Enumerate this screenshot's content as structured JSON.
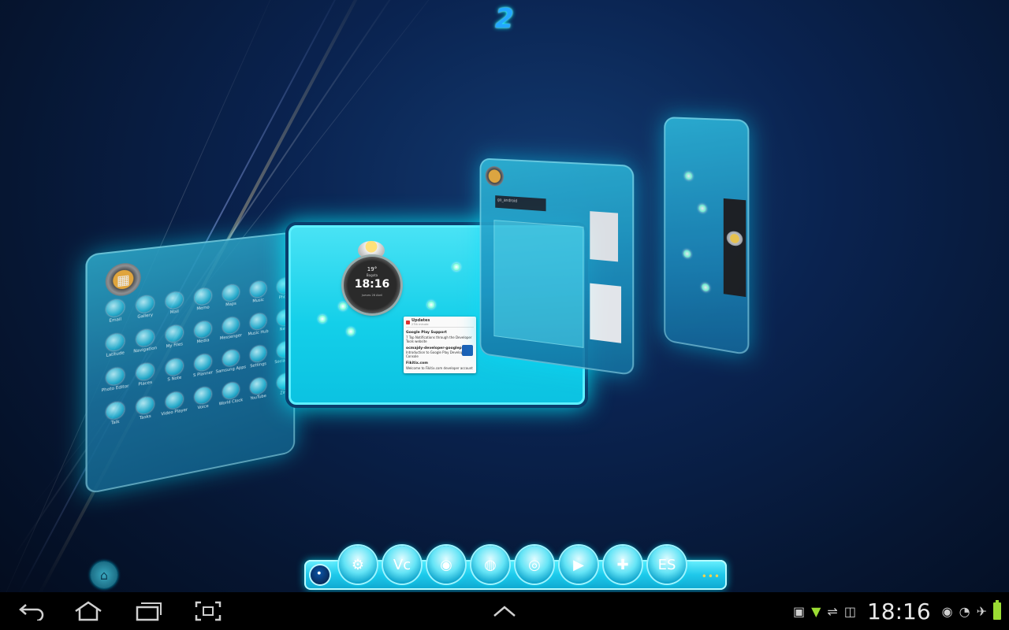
{
  "page_indicator": "2",
  "screens": {
    "left": {
      "apps": [
        {
          "label": "Email"
        },
        {
          "label": "Gallery"
        },
        {
          "label": "Mail"
        },
        {
          "label": "Memo"
        },
        {
          "label": "Maps"
        },
        {
          "label": "Music"
        },
        {
          "label": "Phone"
        },
        {
          "label": "Latitude"
        },
        {
          "label": "Navigation"
        },
        {
          "label": "My Files"
        },
        {
          "label": "Media"
        },
        {
          "label": "Messenger"
        },
        {
          "label": "Music Hub"
        },
        {
          "label": "News"
        },
        {
          "label": "Photo Editor"
        },
        {
          "label": "Places"
        },
        {
          "label": "S Note"
        },
        {
          "label": "S Planner"
        },
        {
          "label": "Samsung Apps"
        },
        {
          "label": "Settings"
        },
        {
          "label": "Social Hub"
        },
        {
          "label": "Talk"
        },
        {
          "label": "Tasks"
        },
        {
          "label": "Video Player"
        },
        {
          "label": "Voice"
        },
        {
          "label": "World Clock"
        },
        {
          "label": "YouTube"
        },
        {
          "label": "Zinio"
        }
      ]
    },
    "center": {
      "clock": {
        "temperature": "19°",
        "city": "Bogota",
        "time": "18:16",
        "date": "Jueves 26 Abril"
      },
      "notification": {
        "header": "Updates",
        "header_sub": "27th minute",
        "item1_title": "Google Play Support",
        "item1_text": "7 Top Notifications through the Developer Tools website",
        "item2_title": "ocmajdy-developer-googleplay",
        "item2_text": "Introduction to Google Play Developer Console",
        "item3_title": "Fikitix.com",
        "item3_text": "Welcome to Fikitix.com developer account"
      }
    },
    "right1": {
      "bar_text": "go_android"
    }
  },
  "dock": {
    "apps": [
      {
        "icon": "settings-icon",
        "glyph": "⚙"
      },
      {
        "icon": "vc-app-icon",
        "glyph": "Vc"
      },
      {
        "icon": "camera-icon",
        "glyph": "◉"
      },
      {
        "icon": "browser-globe-icon",
        "glyph": "◍"
      },
      {
        "icon": "chrome-icon",
        "glyph": "◎"
      },
      {
        "icon": "play-store-icon",
        "glyph": "▶"
      },
      {
        "icon": "maps-icon",
        "glyph": "✚"
      },
      {
        "icon": "es-file-explorer-icon",
        "glyph": "ES"
      }
    ],
    "more": "•••"
  },
  "statusbar": {
    "time": "18:16"
  },
  "colors": {
    "accent": "#1fc8ea",
    "background": "#0a2350",
    "battery": "#9bdc33"
  }
}
